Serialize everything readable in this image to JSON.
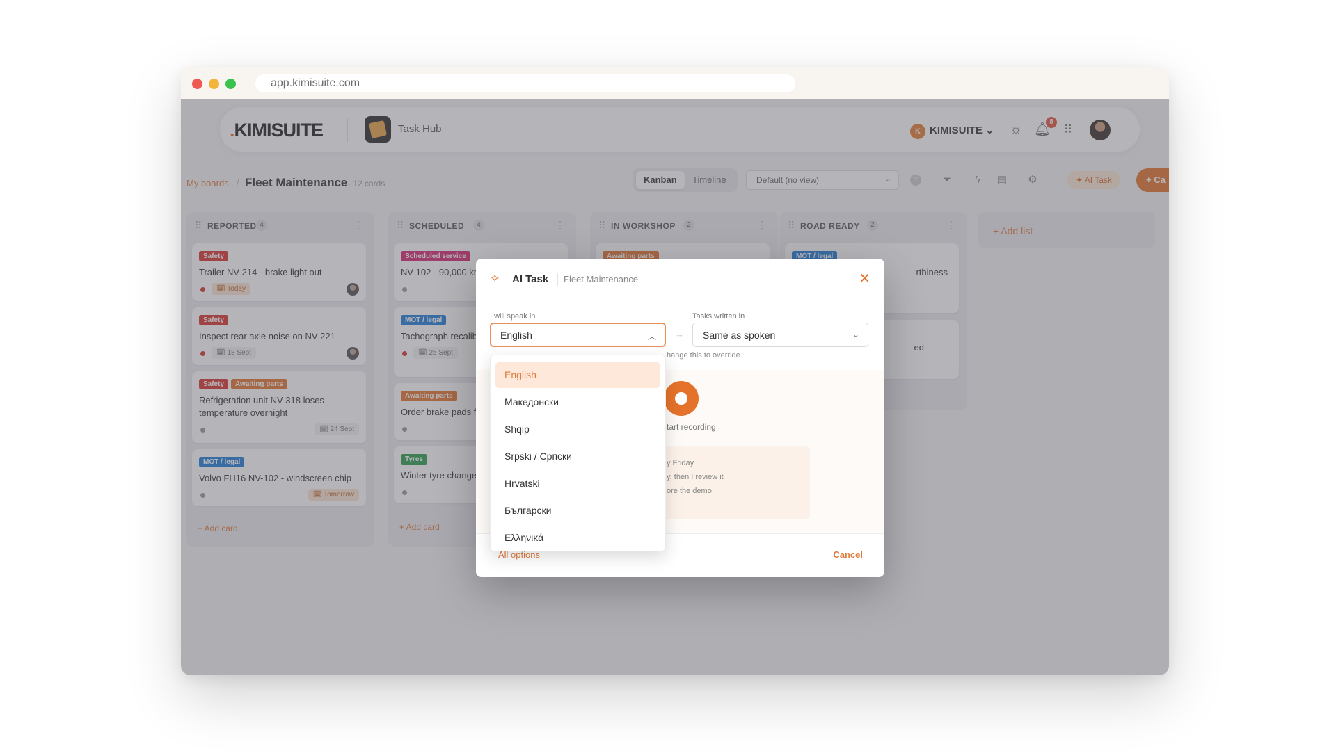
{
  "browser": {
    "url": "app.kimisuite.com"
  },
  "topbar": {
    "logo": "KIMISUITE",
    "hub_name": "Task Hub",
    "org_initial": "K",
    "org_name": "KIMISUITE",
    "notification_count": "8"
  },
  "subheader": {
    "crumb_root": "My boards",
    "board_title": "Fleet Maintenance",
    "card_count": "· 12 cards",
    "view_tabs": [
      "Kanban",
      "Timeline"
    ],
    "view_select": "Default (no view)",
    "ai_button": "AI Task",
    "create_button": "+ Ca"
  },
  "columns": [
    {
      "title": "REPORTED",
      "count": "4",
      "add": "+ Add card",
      "cards": [
        {
          "tags": [
            "Safety"
          ],
          "title": "Trailer NV-214 - brake light out",
          "due": "Today"
        },
        {
          "tags": [
            "Safety"
          ],
          "title": "Inspect rear axle noise on NV-221",
          "due": "18 Sept"
        },
        {
          "tags": [
            "Safety",
            "Awaiting parts"
          ],
          "title": "Refrigeration unit NV-318 loses temperature overnight",
          "due": "24 Sept"
        },
        {
          "tags": [
            "MOT / legal"
          ],
          "title": "Volvo FH16 NV-102 - windscreen chip",
          "due": "Tomorrow"
        }
      ]
    },
    {
      "title": "SCHEDULED",
      "count": "4",
      "add": "+ Add card",
      "cards": [
        {
          "tags": [
            "Scheduled service"
          ],
          "title": "NV-102 - 90,000 km"
        },
        {
          "tags": [
            "MOT / legal"
          ],
          "title": "Tachograph recalib NV-140",
          "due": "25 Sept"
        },
        {
          "tags": [
            "Awaiting parts"
          ],
          "title": "Order brake pads f"
        },
        {
          "tags": [
            "Tyres"
          ],
          "title": "Winter tyre change"
        }
      ]
    },
    {
      "title": "IN WORKSHOP",
      "count": "2",
      "cards": [
        {
          "tags": [
            "Awaiting parts"
          ]
        }
      ]
    },
    {
      "title": "ROAD READY",
      "count": "2",
      "cards": [
        {
          "tags": [
            "MOT / legal"
          ],
          "title": "rthiness"
        },
        {
          "title": "ed"
        }
      ]
    }
  ],
  "add_list": "+ Add list",
  "modal": {
    "title": "AI Task",
    "board": "Fleet Maintenance",
    "speak_label": "I will speak in",
    "speak_value": "English",
    "written_label": "Tasks written in",
    "written_value": "Same as spoken",
    "hint": "hange this to override.",
    "record_label": "tart recording",
    "examples": [
      "y Friday",
      "y, then I review it",
      "ore the demo"
    ],
    "all_options": "All options",
    "cancel": "Cancel"
  },
  "dropdown": {
    "options": [
      "English",
      "Македонски",
      "Shqip",
      "Srpski / Српски",
      "Hrvatski",
      "Български",
      "Ελληνικά"
    ],
    "selected": "English"
  },
  "colors": {
    "accent": "#e4722a",
    "safety": "#d8312c",
    "mot": "#1e7bd7",
    "scheduled": "#d3266e",
    "tyres": "#2a9d4a"
  }
}
